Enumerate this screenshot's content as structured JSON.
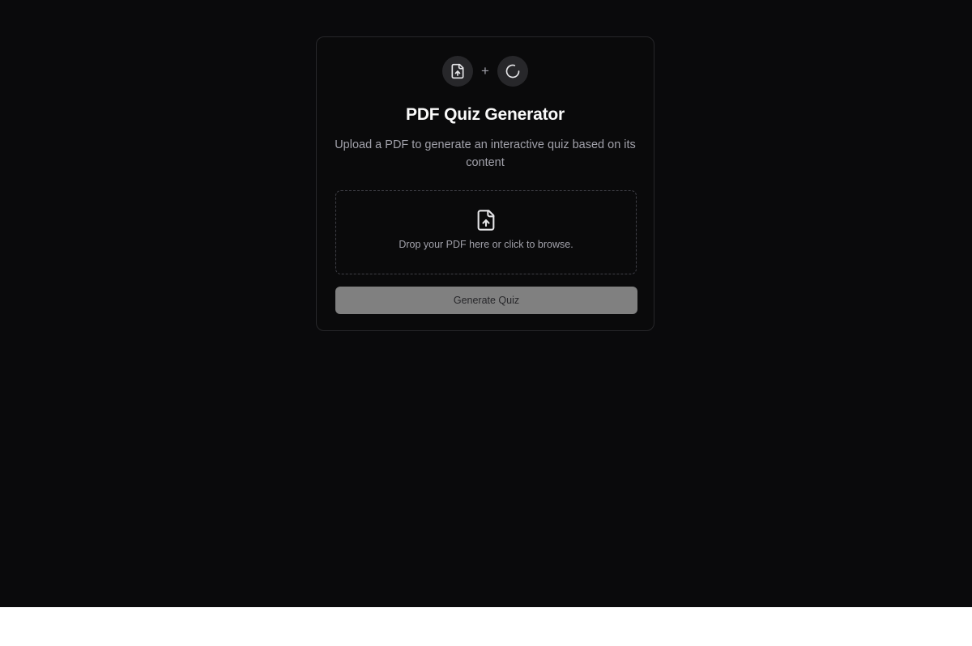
{
  "header": {
    "icons": [
      "file-upload-icon",
      "plus-icon",
      "loader-icon"
    ],
    "plus_symbol": "+",
    "title": "PDF Quiz Generator",
    "subtitle": "Upload a PDF to generate an interactive quiz based on its content"
  },
  "dropzone": {
    "icon": "file-upload-icon",
    "text": "Drop your PDF here or click to browse."
  },
  "actions": {
    "generate_label": "Generate Quiz"
  },
  "colors": {
    "background": "#0a0a0c",
    "card_border": "#27272a",
    "title": "#fafafa",
    "muted_text": "#a1a1aa",
    "button_disabled": "#808080"
  }
}
